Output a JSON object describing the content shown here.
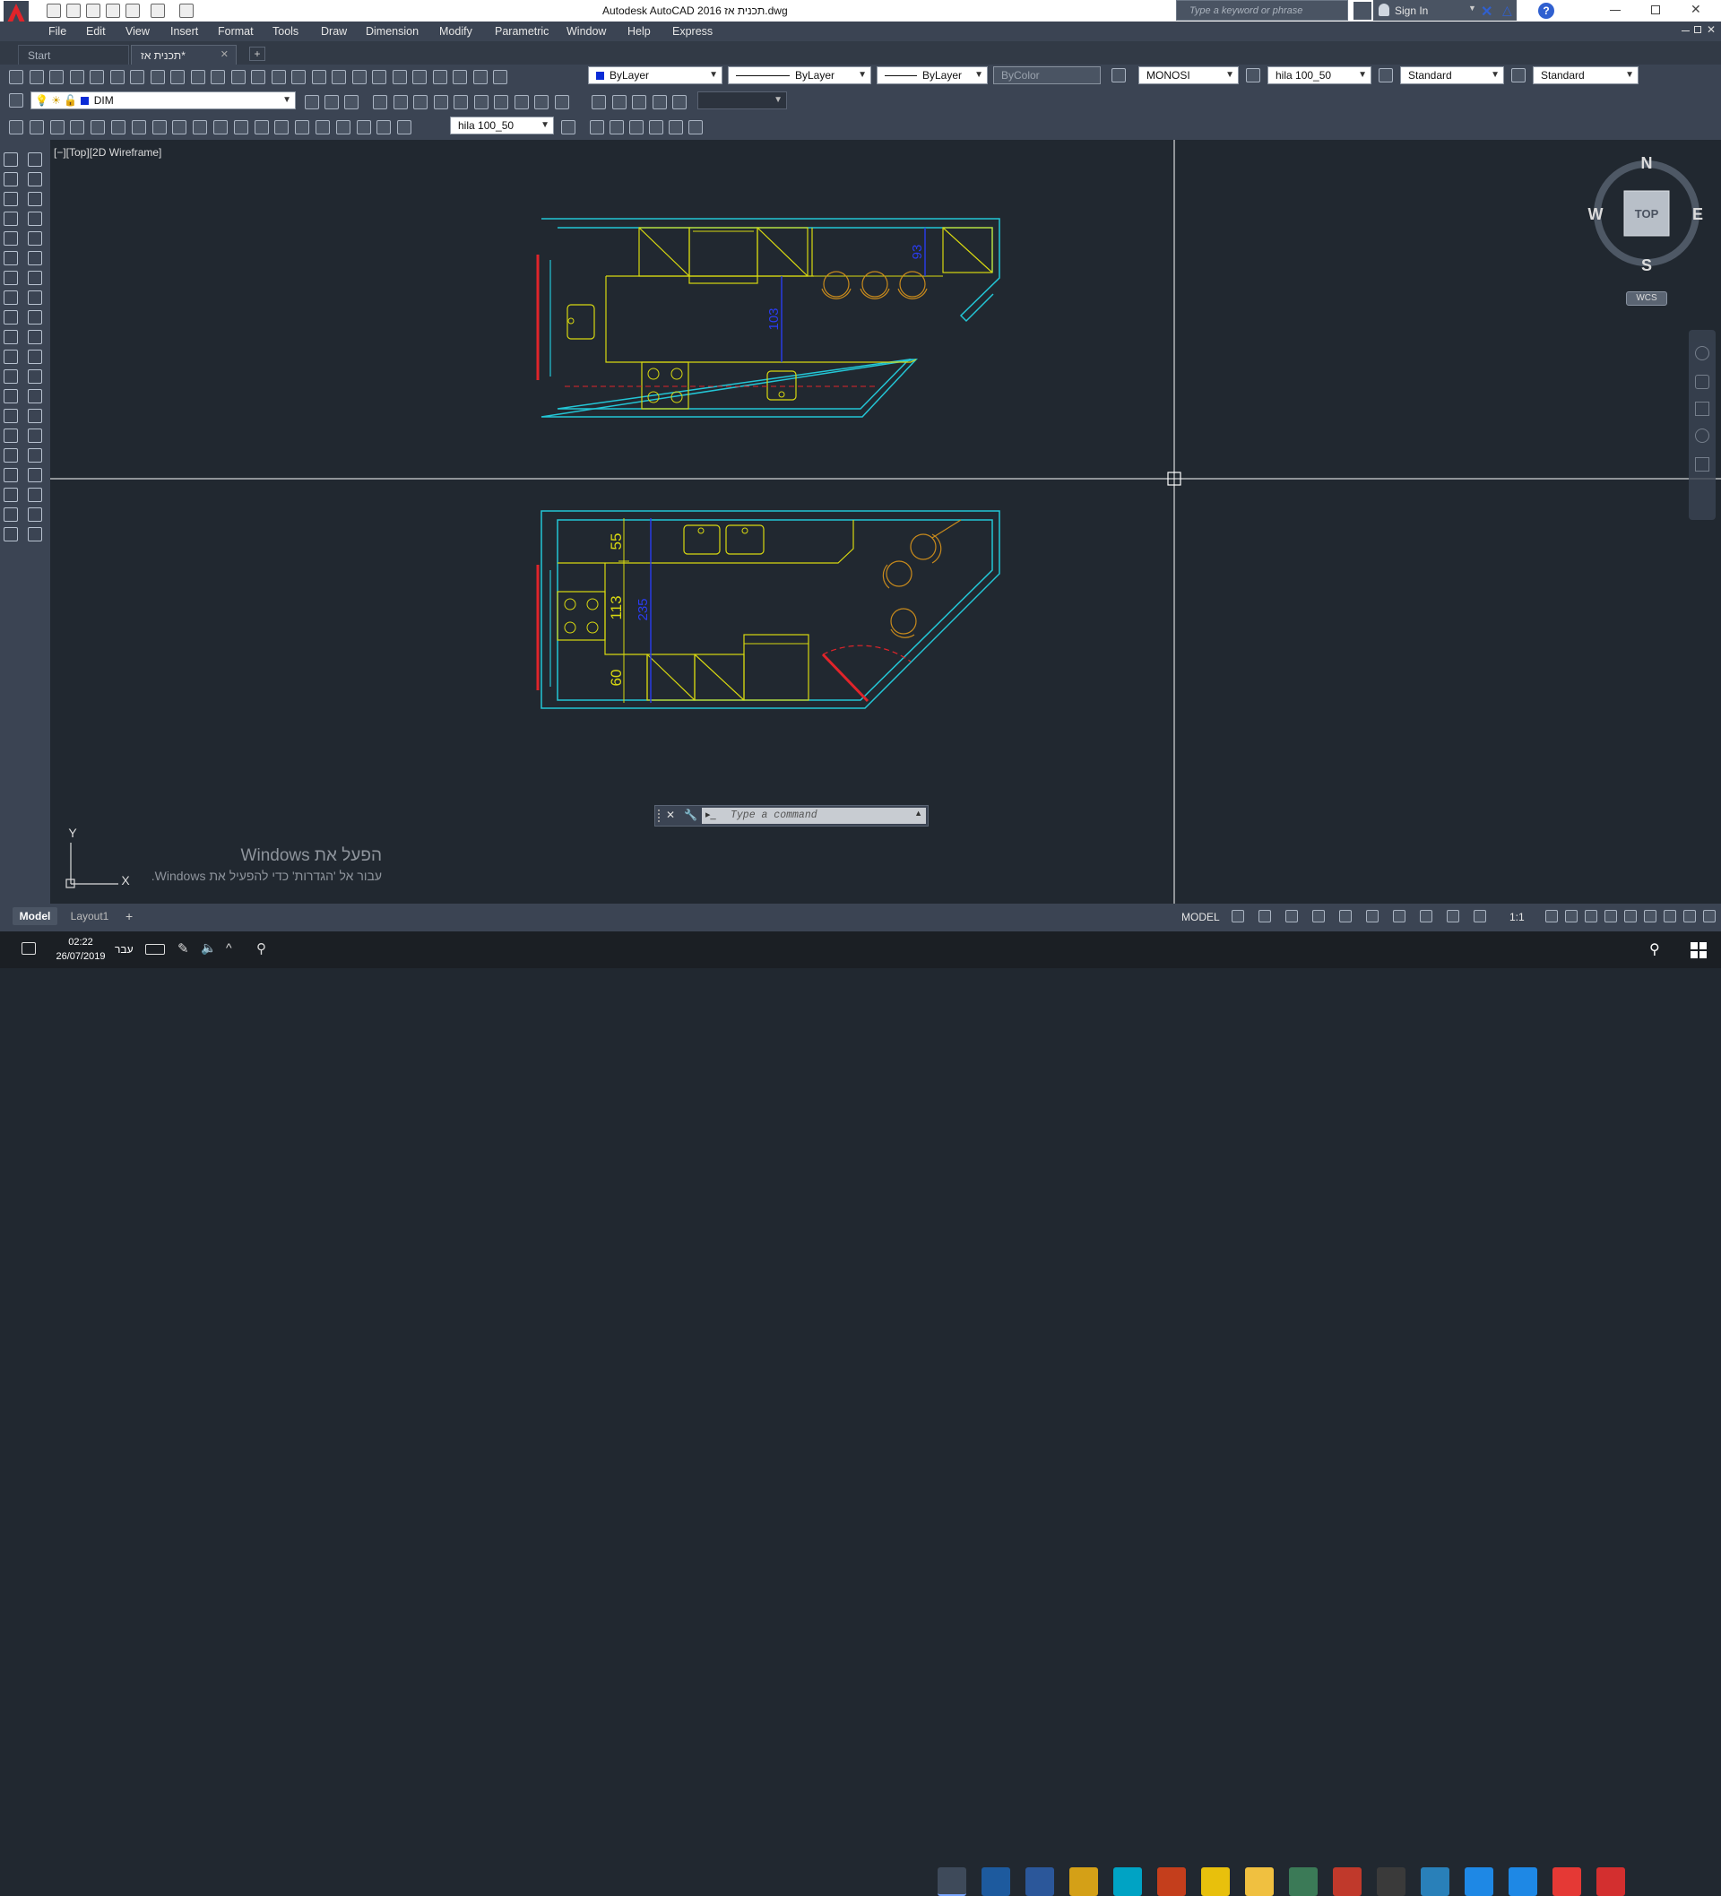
{
  "window": {
    "title": "Autodesk AutoCAD 2016   תכנית אז.dwg",
    "search_placeholder": "Type a keyword or phrase",
    "sign_in": "Sign In",
    "help": "?"
  },
  "menu": [
    "File",
    "Edit",
    "View",
    "Insert",
    "Format",
    "Tools",
    "Draw",
    "Dimension",
    "Modify",
    "Parametric",
    "Window",
    "Help",
    "Express"
  ],
  "tabs": {
    "start": "Start",
    "drawing": "תכנית אז*",
    "add": "+"
  },
  "properties": {
    "color": "ByLayer",
    "linetype": "ByLayer",
    "lineweight": "ByLayer",
    "plotstyle": "ByColor",
    "text_style": "MONOSI",
    "dim_style": "hila 100_50",
    "table_style": "Standard",
    "multileader_style": "Standard",
    "layer": "DIM",
    "dim_style_2": "hila 100_50"
  },
  "viewport": {
    "label": "[−][Top][2D Wireframe]",
    "viewcube": {
      "n": "N",
      "s": "S",
      "e": "E",
      "w": "W",
      "top": "TOP",
      "wcs": "WCS"
    },
    "ucs": {
      "x": "X",
      "y": "Y"
    }
  },
  "dimensions": {
    "top_plan": [
      "93",
      "103"
    ],
    "bottom_plan": [
      "55",
      "113",
      "60",
      "235"
    ]
  },
  "command": {
    "placeholder": "Type a command"
  },
  "watermark": {
    "line1": "הפעל את Windows",
    "line2": "עבור אל 'הגדרות' כדי להפעיל את Windows."
  },
  "layouts": {
    "model": "Model",
    "layout1": "Layout1",
    "add": "+"
  },
  "status": {
    "model": "MODEL",
    "scale": "1:1"
  },
  "taskbar": {
    "time": "02:22",
    "date": "26/07/2019",
    "lang": "עבר"
  },
  "colors": {
    "cyan": "#23c6d6",
    "yellow": "#d8d810",
    "red": "#e0242a",
    "blue": "#2a3cf0",
    "orange": "#c88a1c"
  }
}
